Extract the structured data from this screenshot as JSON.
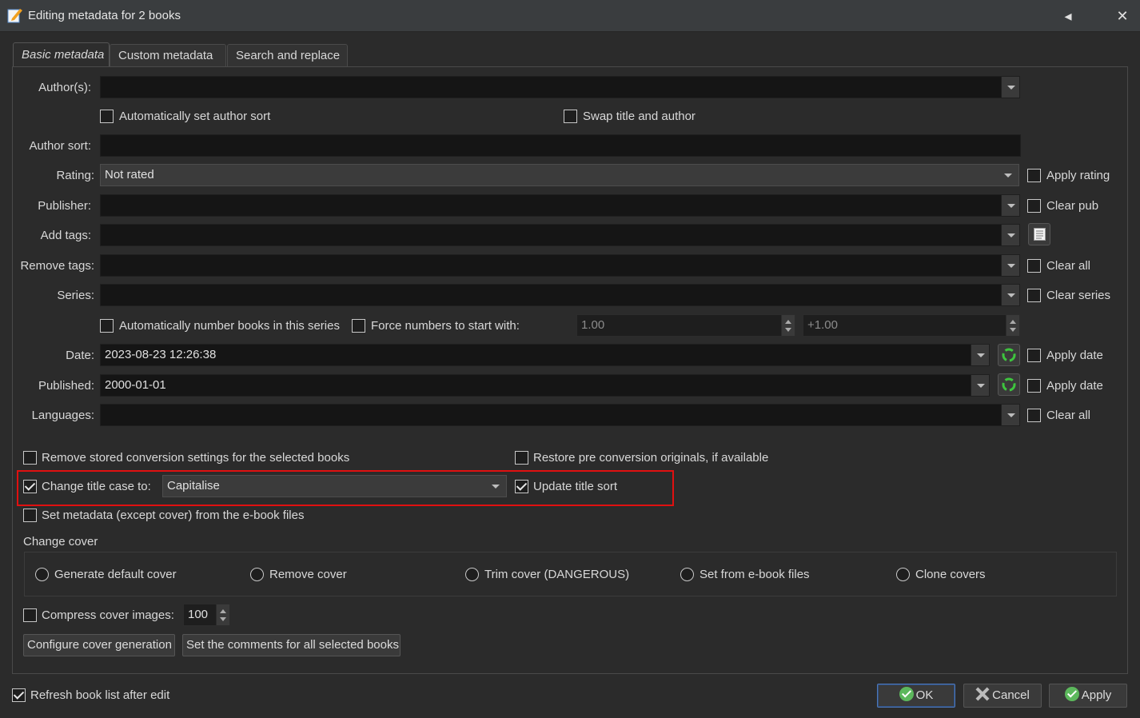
{
  "window": {
    "title": "Editing metadata for 2 books"
  },
  "tabs": [
    "Basic metadata",
    "Custom metadata",
    "Search and replace"
  ],
  "fields": {
    "authors_label": "Author(s):",
    "auto_author_sort": "Automatically set author sort",
    "swap_title_author": "Swap title and author",
    "author_sort_label": "Author sort:",
    "rating_label": "Rating:",
    "rating_value": "Not rated",
    "apply_rating": "Apply rating",
    "publisher_label": "Publisher:",
    "clear_pub": "Clear pub",
    "add_tags_label": "Add tags:",
    "remove_tags_label": "Remove tags:",
    "clear_all": "Clear all",
    "series_label": "Series:",
    "clear_series": "Clear series",
    "auto_number": "Automatically number books in this series",
    "force_numbers": "Force numbers to start with:",
    "series_start": "1.00",
    "series_increment": "+1.00",
    "date_label": "Date:",
    "date_value": "2023-08-23 12:26:38",
    "apply_date": "Apply date",
    "published_label": "Published:",
    "published_value": "2000-01-01",
    "apply_pubdate": "Apply date",
    "languages_label": "Languages:",
    "clear_languages": "Clear all"
  },
  "options": {
    "remove_conversion": "Remove stored conversion settings for the selected books",
    "restore_originals": "Restore pre conversion originals, if available",
    "change_title_case": "Change title case to:",
    "title_case_value": "Capitalise",
    "update_title_sort": "Update title sort",
    "set_metadata_from_files": "Set metadata (except cover) from the e-book files",
    "change_cover_label": "Change cover",
    "cover_options": [
      "Generate default cover",
      "Remove cover",
      "Trim cover (DANGEROUS)",
      "Set from e-book files",
      "Clone covers"
    ],
    "compress_cover": "Compress cover images:",
    "compress_value": "100",
    "configure_cover_btn": "Configure cover generation",
    "set_comments_btn": "Set the comments for all selected books"
  },
  "footer": {
    "refresh_list": "Refresh book list after edit",
    "ok": "OK",
    "cancel": "Cancel",
    "apply": "Apply"
  },
  "colors": {
    "highlight": "#e01010",
    "ok_green": "#5cb85c"
  }
}
